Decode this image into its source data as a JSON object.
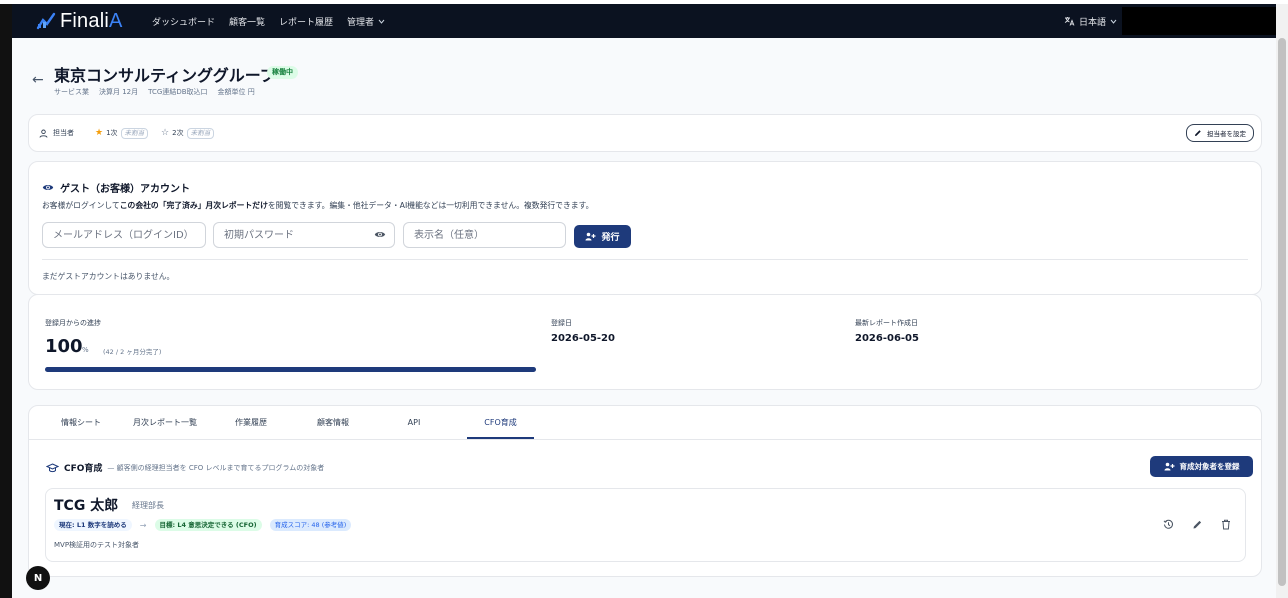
{
  "header": {
    "logo_text": "Finali",
    "logo_accent": "A",
    "nav": [
      {
        "label": "ダッシュボード"
      },
      {
        "label": "顧客一覧"
      },
      {
        "label": "レポート履歴"
      },
      {
        "label": "管理者"
      }
    ],
    "language": "日本語"
  },
  "company": {
    "name": "東京コンサルティンググループ",
    "status": "稼働中",
    "meta": [
      "サービス業",
      "決算月 12月",
      "TCG連結DB取込口",
      "金額単位 円"
    ]
  },
  "assignee": {
    "label": "担当者",
    "primary_label": "1次",
    "primary_value": "未割当",
    "secondary_label": "2次",
    "secondary_value": "未割当",
    "set_button": "担当者を設定"
  },
  "guest": {
    "title": "ゲスト（お客様）アカウント",
    "desc_1": "お客様がログインして",
    "desc_bold_1": "この会社の「完了済み」月次レポートだけ",
    "desc_2": "を閲覧できます。編集・他社データ・AI機能などは一切利用できません。複数発行できます。",
    "email_placeholder": "メールアドレス（ログインID）",
    "password_placeholder": "初期パスワード",
    "display_placeholder": "表示名（任意）",
    "issue_button": "発行",
    "empty_text": "まだゲストアカウントはありません。"
  },
  "progress": {
    "label": "登録月からの進捗",
    "value": "100",
    "unit": "%",
    "sub": "(42 / 2 ヶ月分完了)",
    "fraction": 1.0,
    "registered_label": "登録日",
    "registered_value": "2026-05-20",
    "latest_label": "最新レポート作成日",
    "latest_value": "2026-06-05"
  },
  "tabs": [
    {
      "label": "情報シート"
    },
    {
      "label": "月次レポート一覧"
    },
    {
      "label": "作業履歴"
    },
    {
      "label": "顧客情報"
    },
    {
      "label": "API"
    },
    {
      "label": "CFO育成"
    }
  ],
  "cfo": {
    "title": "CFO育成",
    "desc": "— 顧客側の経理担当者を CFO レベルまで育てるプログラムの対象者",
    "register_button": "育成対象者を登録",
    "trainee": {
      "name": "TCG 太郎",
      "role": "経理部長",
      "current": "現在: L1 数字を読める",
      "arrow": "→",
      "goal": "目標: L4 意思決定できる (CFO)",
      "score": "育成スコア: 48 (参考値)",
      "note": "MVP検証用のテスト対象者"
    }
  },
  "misc": {
    "n_badge": "N"
  },
  "colors": {
    "primary": "#1e3a7b",
    "accent": "#3b82f6",
    "status_bg": "#dcfce7",
    "status_text": "#15803d"
  }
}
